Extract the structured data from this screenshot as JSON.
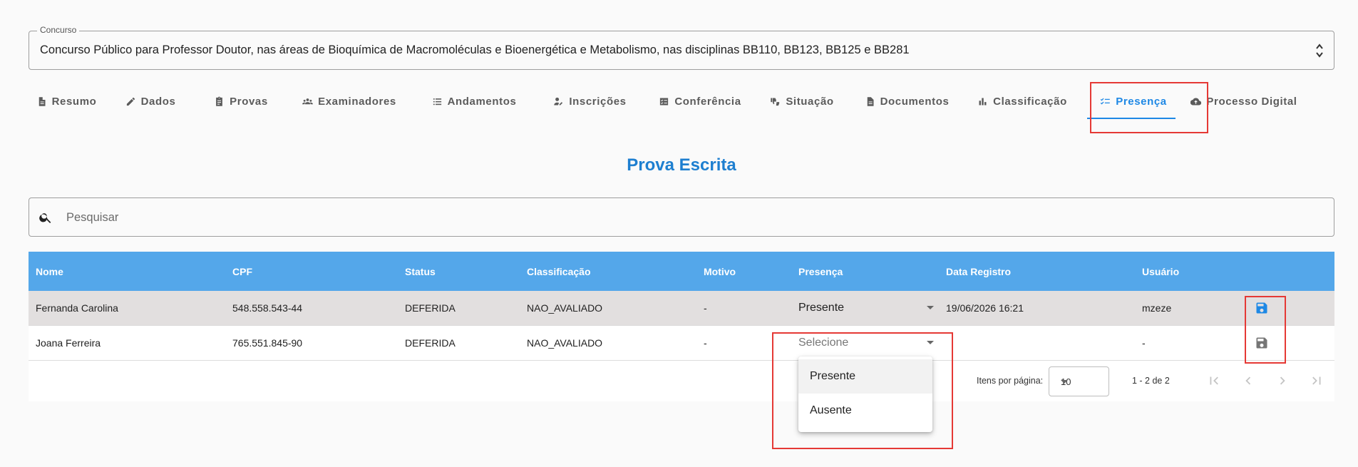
{
  "concurso": {
    "label": "Concurso",
    "value": "Concurso Público para Professor Doutor, nas áreas de Bioquímica de Macromoléculas e Bioenergética e Metabolismo, nas disciplinas BB110, BB123, BB125 e BB281"
  },
  "tabs": [
    {
      "label": "Resumo",
      "icon": "document-icon"
    },
    {
      "label": "Dados",
      "icon": "pencil-icon"
    },
    {
      "label": "Provas",
      "icon": "clipboard-icon"
    },
    {
      "label": "Examinadores",
      "icon": "group-icon"
    },
    {
      "label": "Andamentos",
      "icon": "list-icon"
    },
    {
      "label": "Inscrições",
      "icon": "person-edit-icon"
    },
    {
      "label": "Conferência",
      "icon": "checklist-card-icon"
    },
    {
      "label": "Situação",
      "icon": "thumbs-icon"
    },
    {
      "label": "Documentos",
      "icon": "document-icon"
    },
    {
      "label": "Classificação",
      "icon": "bar-chart-icon"
    },
    {
      "label": "Presença",
      "icon": "checklist-icon",
      "active": true
    },
    {
      "label": "Processo Digital",
      "icon": "cloud-upload-icon"
    }
  ],
  "section_title": "Prova Escrita",
  "search": {
    "placeholder": "Pesquisar"
  },
  "table": {
    "headers": {
      "nome": "Nome",
      "cpf": "CPF",
      "status": "Status",
      "classificacao": "Classificação",
      "motivo": "Motivo",
      "presenca": "Presença",
      "data": "Data Registro",
      "usuario": "Usuário"
    },
    "rows": [
      {
        "nome": "Fernanda Carolina",
        "cpf": "548.558.543-44",
        "status": "DEFERIDA",
        "classificacao": "NAO_AVALIADO",
        "motivo": "-",
        "presenca": "Presente",
        "data": "19/06/2026 16:21",
        "usuario": "mzeze"
      },
      {
        "nome": "Joana Ferreira",
        "cpf": "765.551.845-90",
        "status": "DEFERIDA",
        "classificacao": "NAO_AVALIADO",
        "motivo": "-",
        "presenca": "Selecione",
        "data": "",
        "usuario": "-"
      }
    ]
  },
  "paginator": {
    "items_label": "Itens por página:",
    "page_size": "10",
    "range": "1 - 2 de 2"
  },
  "dropdown": {
    "options": [
      "Presente",
      "Ausente"
    ]
  },
  "colors": {
    "accent": "#1e88e5",
    "header_bg": "#54a7ea",
    "highlight": "#e53935",
    "save_active": "#1e88e5",
    "save_inactive": "#757575"
  }
}
